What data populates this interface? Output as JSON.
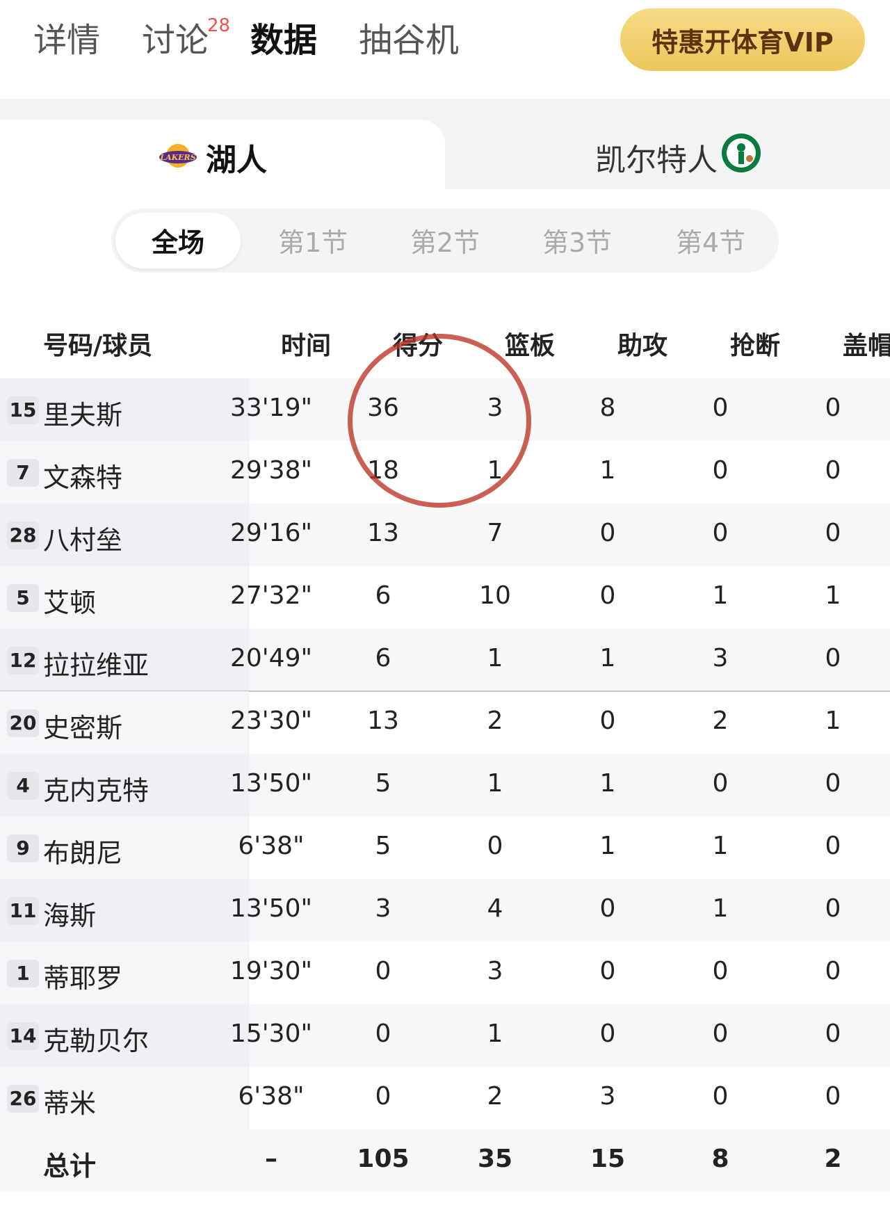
{
  "nav": {
    "tabs": [
      {
        "label": "详情"
      },
      {
        "label": "讨论",
        "badge": "28"
      },
      {
        "label": "数据"
      },
      {
        "label": "抽谷机"
      }
    ],
    "active_tab": "数据",
    "vip_button": "特惠开体育VIP"
  },
  "teams": {
    "left": {
      "name": "湖人",
      "logo": "lakers-logo"
    },
    "right": {
      "name": "凯尔特人",
      "logo": "celtics-logo"
    }
  },
  "periods": [
    "全场",
    "第1节",
    "第2节",
    "第3节",
    "第4节"
  ],
  "active_period": "全场",
  "table": {
    "headers": [
      "号码/球员",
      "时间",
      "得分",
      "篮板",
      "助攻",
      "抢断",
      "盖帽"
    ],
    "rows": [
      {
        "number": "15",
        "name": "里夫斯",
        "time": "33'19\"",
        "pts": "36",
        "reb": "3",
        "ast": "8",
        "stl": "0",
        "blk": "0"
      },
      {
        "number": "7",
        "name": "文森特",
        "time": "29'38\"",
        "pts": "18",
        "reb": "1",
        "ast": "1",
        "stl": "0",
        "blk": "0"
      },
      {
        "number": "28",
        "name": "八村垒",
        "time": "29'16\"",
        "pts": "13",
        "reb": "7",
        "ast": "0",
        "stl": "0",
        "blk": "0"
      },
      {
        "number": "5",
        "name": "艾顿",
        "time": "27'32\"",
        "pts": "6",
        "reb": "10",
        "ast": "0",
        "stl": "1",
        "blk": "1"
      },
      {
        "number": "12",
        "name": "拉拉维亚",
        "time": "20'49\"",
        "pts": "6",
        "reb": "1",
        "ast": "1",
        "stl": "3",
        "blk": "0"
      },
      {
        "number": "20",
        "name": "史密斯",
        "time": "23'30\"",
        "pts": "13",
        "reb": "2",
        "ast": "0",
        "stl": "2",
        "blk": "1"
      },
      {
        "number": "4",
        "name": "克内克特",
        "time": "13'50\"",
        "pts": "5",
        "reb": "1",
        "ast": "1",
        "stl": "0",
        "blk": "0"
      },
      {
        "number": "9",
        "name": "布朗尼",
        "time": "6'38\"",
        "pts": "5",
        "reb": "0",
        "ast": "1",
        "stl": "1",
        "blk": "0"
      },
      {
        "number": "11",
        "name": "海斯",
        "time": "13'50\"",
        "pts": "3",
        "reb": "4",
        "ast": "0",
        "stl": "1",
        "blk": "0"
      },
      {
        "number": "1",
        "name": "蒂耶罗",
        "time": "19'30\"",
        "pts": "0",
        "reb": "3",
        "ast": "0",
        "stl": "0",
        "blk": "0"
      },
      {
        "number": "14",
        "name": "克勒贝尔",
        "time": "15'30\"",
        "pts": "0",
        "reb": "1",
        "ast": "0",
        "stl": "0",
        "blk": "0"
      },
      {
        "number": "26",
        "name": "蒂米",
        "time": "6'38\"",
        "pts": "0",
        "reb": "2",
        "ast": "3",
        "stl": "0",
        "blk": "0"
      }
    ],
    "total": {
      "label": "总计",
      "time": "–",
      "pts": "105",
      "reb": "35",
      "ast": "15",
      "stl": "8",
      "blk": "2"
    }
  },
  "colors": {
    "vip_gold": "#ecc65b",
    "badge_red": "#e9544a",
    "annotation_red": "#be3223"
  }
}
